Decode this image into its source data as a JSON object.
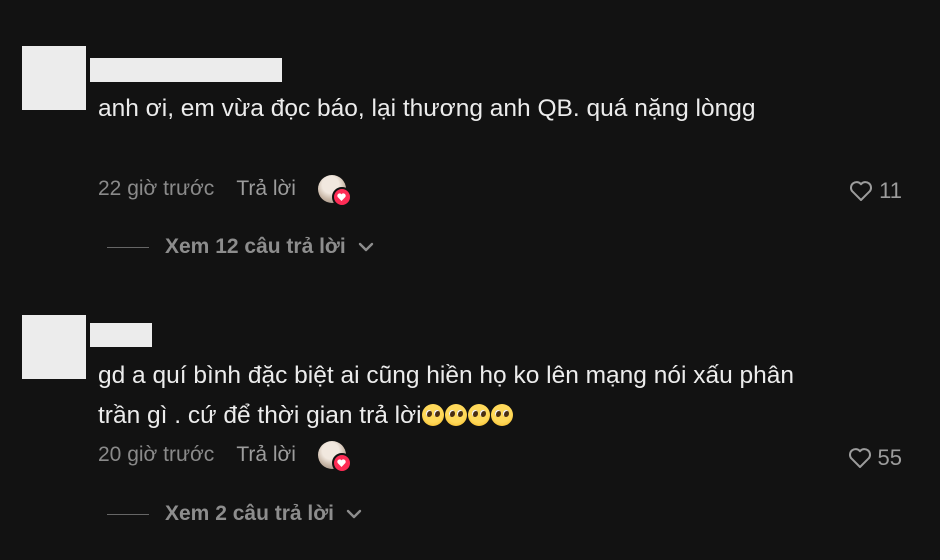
{
  "comments": [
    {
      "text": "anh ơi, em vừa đọc báo, lại thương anh QB. quá nặng lòngg",
      "time": "22 giờ trước",
      "reply_label": "Trả lời",
      "likes": "11",
      "view_replies": "Xem 12 câu trả lời",
      "emojis": []
    },
    {
      "text": "gd a quí bình đặc biệt ai cũng hiền họ ko lên mạng nói xấu phân trần gì . cứ để thời gian trả lời",
      "time": "20 giờ trước",
      "reply_label": "Trả lời",
      "likes": "55",
      "view_replies": "Xem 2 câu trả lời",
      "emojis": [
        "pleading-face",
        "pleading-face",
        "pleading-face",
        "pleading-face"
      ]
    }
  ],
  "colors": {
    "background": "#121212",
    "text": "#ececec",
    "muted": "#8a8a8a",
    "heart_badge": "#fe2c55"
  }
}
